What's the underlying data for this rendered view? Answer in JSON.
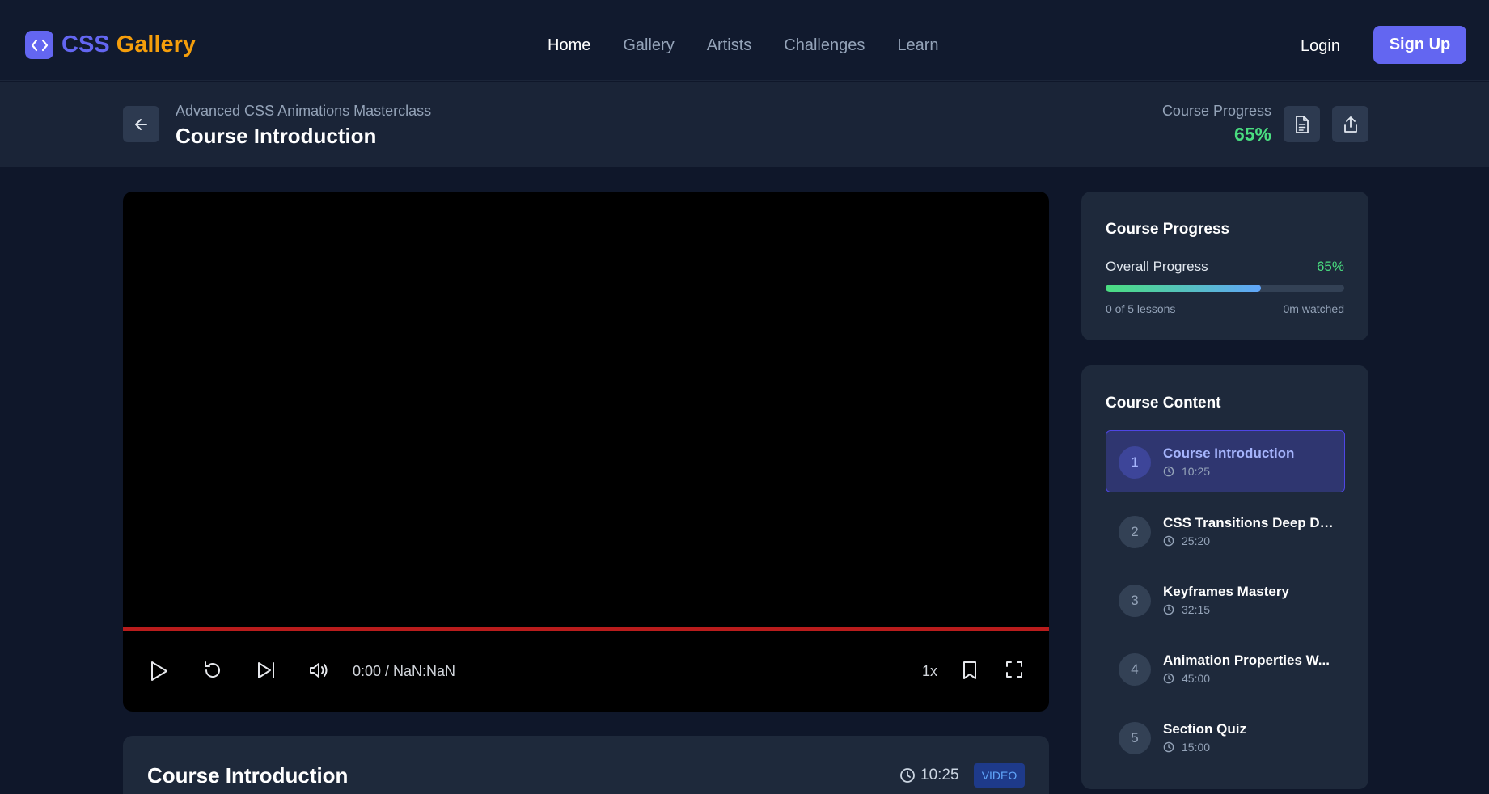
{
  "brand": {
    "part1": "CSS",
    "part2": "Gallery"
  },
  "nav": {
    "links": [
      {
        "label": "Home",
        "active": true
      },
      {
        "label": "Gallery",
        "active": false
      },
      {
        "label": "Artists",
        "active": false
      },
      {
        "label": "Challenges",
        "active": false
      },
      {
        "label": "Learn",
        "active": false
      }
    ],
    "login": "Login",
    "signup": "Sign Up"
  },
  "header": {
    "course_name": "Advanced CSS Animations Masterclass",
    "lesson_title": "Course Introduction",
    "progress_label": "Course Progress",
    "progress_value": "65%"
  },
  "player": {
    "time": "0:00 / NaN:NaN",
    "speed": "1x"
  },
  "lesson": {
    "title": "Course Introduction",
    "duration": "10:25",
    "type": "VIDEO"
  },
  "progress_card": {
    "title": "Course Progress",
    "overall_label": "Overall Progress",
    "overall_value": "65%",
    "fill_percent": 65,
    "lessons_count": "0 of 5 lessons",
    "watched": "0m watched"
  },
  "content": {
    "title": "Course Content",
    "lessons": [
      {
        "number": "1",
        "title": "Course Introduction",
        "duration": "10:25",
        "active": true
      },
      {
        "number": "2",
        "title": "CSS Transitions Deep Dive",
        "duration": "25:20",
        "active": false
      },
      {
        "number": "3",
        "title": "Keyframes Mastery",
        "duration": "32:15",
        "active": false
      },
      {
        "number": "4",
        "title": "Animation Properties W...",
        "duration": "45:00",
        "active": false
      },
      {
        "number": "5",
        "title": "Section Quiz",
        "duration": "15:00",
        "active": false
      }
    ]
  },
  "colors": {
    "accent": "#6366f1",
    "brand_secondary": "#f59e0b",
    "success": "#4ade80",
    "progress_track": "#b91c1c"
  }
}
